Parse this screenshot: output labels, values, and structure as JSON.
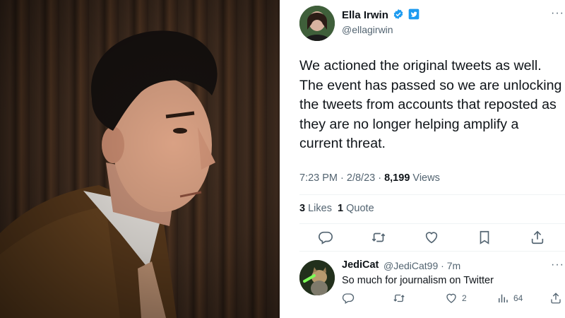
{
  "photo": {
    "alt_icon": "portrait-photo"
  },
  "tweet": {
    "author": {
      "name": "Ella Irwin",
      "handle": "@ellagirwin"
    },
    "text": "We actioned the original tweets as well. The event has passed so we are unlocking the tweets from accounts that reposted as they are no longer helping amplify a current threat.",
    "time": "7:23 PM · 2/8/23 · ",
    "views_count": "8,199",
    "views_label": " Views",
    "likes_count": "3",
    "likes_label": " Likes",
    "quotes_count": "1",
    "quotes_label": " Quote",
    "more": "···"
  },
  "reply": {
    "name": "JediCat",
    "handle": "@JediCat99 · 7m",
    "text": "So much for journalism on Twitter",
    "like_count": "2",
    "views_count": "64",
    "more": "···"
  },
  "colors": {
    "verified_blue": "#1d9bf0",
    "text_primary": "#0f1419",
    "text_secondary": "#536471",
    "divider": "#eff3f4"
  }
}
